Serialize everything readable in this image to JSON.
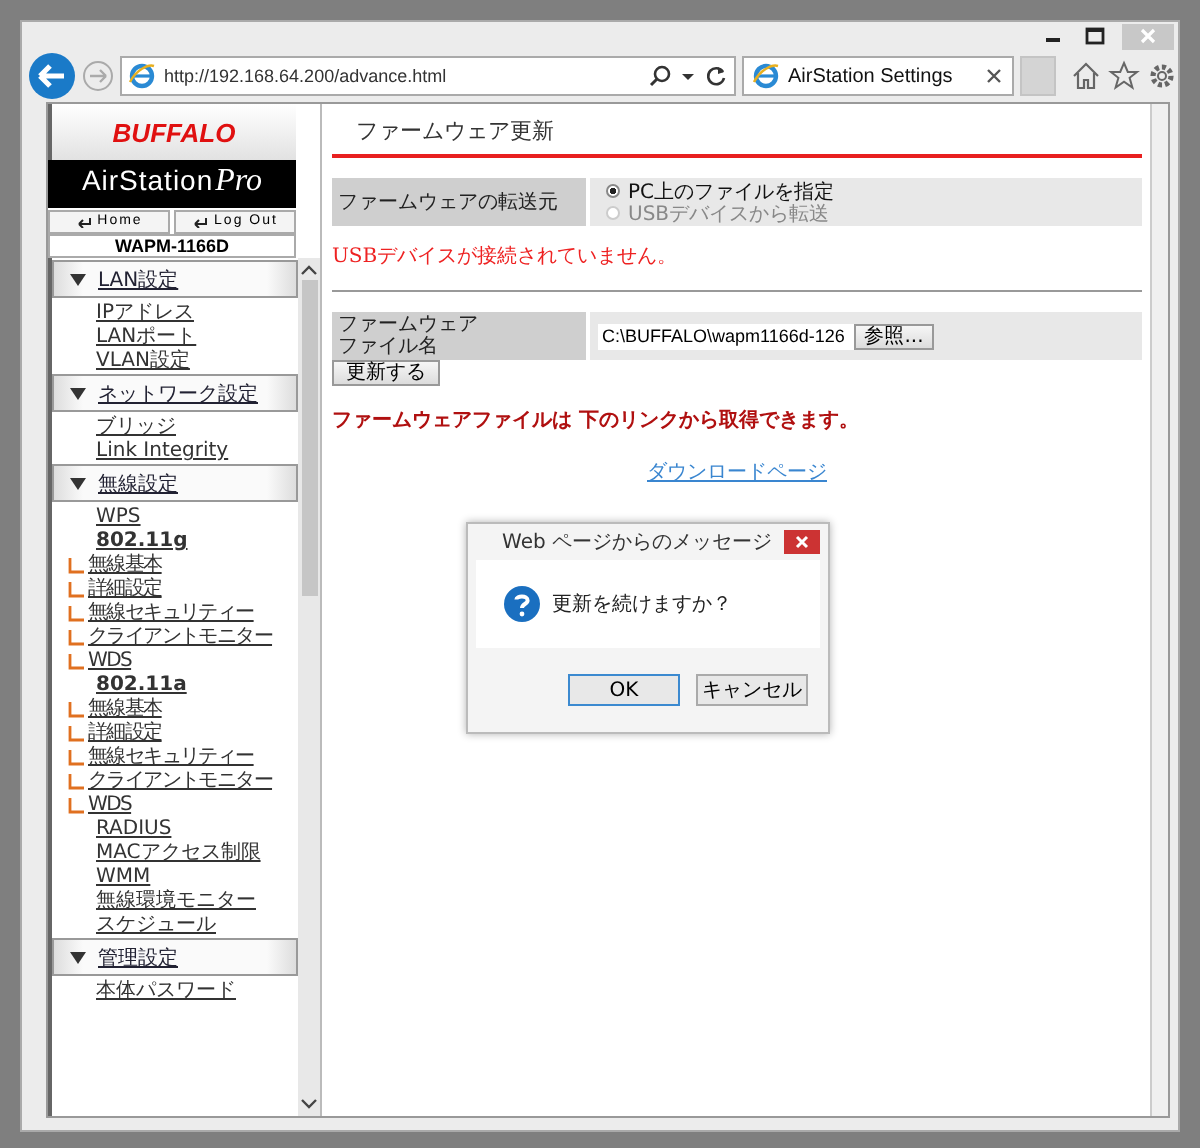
{
  "browser": {
    "address": "http://192.168.64.200/advance.html",
    "tab_title": "AirStation Settings"
  },
  "sidebar": {
    "logo": "BUFFALO",
    "product": "AirStation",
    "product_suffix": "Pro",
    "buttons": [
      "Home",
      "Log Out"
    ],
    "model": "WAPM-1166D",
    "sections": [
      {
        "label": "LAN設定",
        "expanded": true,
        "items": [
          {
            "label": "IPアドレス"
          },
          {
            "label": "LANポート"
          },
          {
            "label": "VLAN設定"
          }
        ]
      },
      {
        "label": "ネットワーク設定",
        "expanded": true,
        "items": [
          {
            "label": "ブリッジ"
          },
          {
            "label": "Link Integrity"
          }
        ]
      },
      {
        "label": "無線設定",
        "expanded": true,
        "items": [
          {
            "label": "WPS"
          },
          {
            "label": "802.11g",
            "children": [
              {
                "label": "無線基本"
              },
              {
                "label": "詳細設定"
              },
              {
                "label": "無線セキュリティー"
              },
              {
                "label": "クライアントモニター"
              },
              {
                "label": "WDS"
              }
            ]
          },
          {
            "label": "802.11a",
            "children": [
              {
                "label": "無線基本"
              },
              {
                "label": "詳細設定"
              },
              {
                "label": "無線セキュリティー"
              },
              {
                "label": "クライアントモニター"
              },
              {
                "label": "WDS"
              }
            ]
          },
          {
            "label": "RADIUS"
          },
          {
            "label": "MACアクセス制限"
          },
          {
            "label": "WMM"
          },
          {
            "label": "無線環境モニター"
          },
          {
            "label": "スケジュール"
          }
        ]
      },
      {
        "label": "管理設定",
        "expanded": true,
        "items": [
          {
            "label": "本体パスワード"
          }
        ]
      }
    ]
  },
  "main": {
    "title": "ファームウェア更新",
    "source": {
      "label": "ファームウェアの転送元",
      "options": [
        {
          "label": "PC上のファイルを指定",
          "selected": true,
          "disabled": false
        },
        {
          "label": "USBデバイスから転送",
          "selected": false,
          "disabled": true
        }
      ]
    },
    "error": "USBデバイスが接続されていません。",
    "file": {
      "label": "ファームウェアファイル名",
      "value": "C:\\BUFFALO\\wapm1166d-126",
      "browse_button": "参照..."
    },
    "update_button": "更新する",
    "note": "ファームウェアファイルは 下のリンクから取得できます。",
    "download_link": "ダウンロードページ"
  },
  "dialog": {
    "title": "Web ページからのメッセージ",
    "message": "更新を続けますか？",
    "buttons": [
      "OK",
      "キャンセル"
    ]
  }
}
